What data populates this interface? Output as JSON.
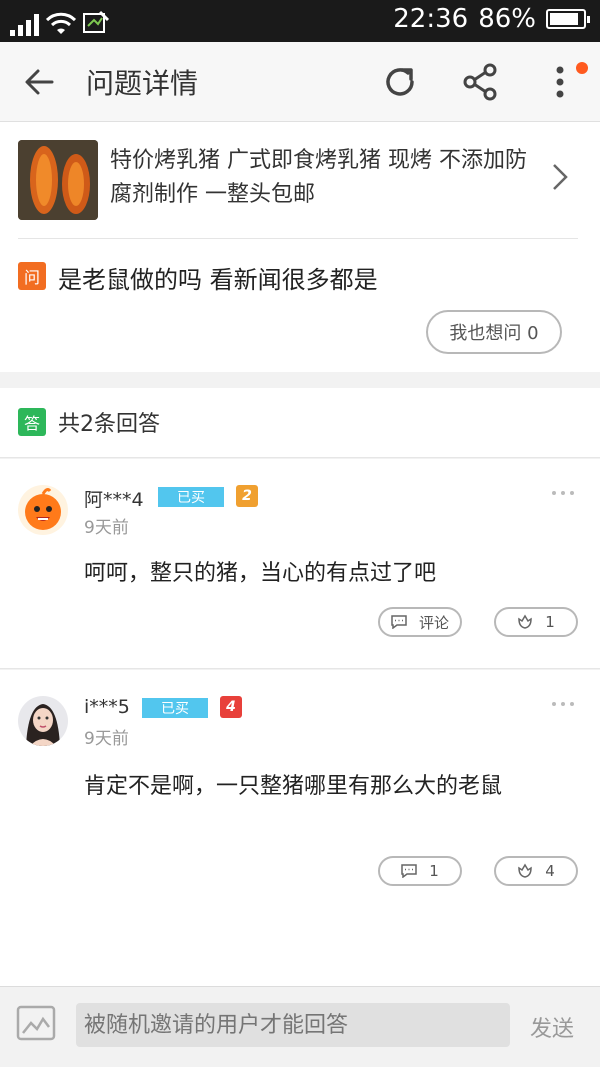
{
  "status_bar": {
    "time": "22:36",
    "battery": "86%"
  },
  "header": {
    "title": "问题详情",
    "icons": [
      "back-arrow-icon",
      "refresh-icon",
      "share-icon",
      "more-vertical-icon"
    ]
  },
  "product": {
    "title": "特价烤乳猪 广式即食烤乳猪 现烤 不添加防腐剂制作 一整头包邮"
  },
  "question": {
    "badge": "问",
    "text": "是老鼠做的吗 看新闻很多都是",
    "ask_too_label": "我也想问 0"
  },
  "answers_header": {
    "badge": "答",
    "count_label": "共2条回答"
  },
  "answers": [
    {
      "user": "阿***4",
      "bought": "已买",
      "vip_level": "2",
      "vip_color": "#f0a030",
      "time": "9天前",
      "text": "呵呵，整只的猪，当心的有点过了吧",
      "comment_label": "评论",
      "like_count": "1"
    },
    {
      "user": "i***5",
      "bought": "已买",
      "vip_level": "4",
      "vip_color": "#e8403a",
      "time": "9天前",
      "text": "肯定不是啊，一只整猪哪里有那么大的老鼠",
      "comment_label": "1",
      "like_count": "4"
    }
  ],
  "input_bar": {
    "placeholder": "被随机邀请的用户才能回答",
    "send_label": "发送"
  },
  "colors": {
    "accent_orange": "#f26d21",
    "answer_green": "#2db75a",
    "bought_blue": "#52c6ee",
    "notify_dot": "#ff5a1f"
  }
}
